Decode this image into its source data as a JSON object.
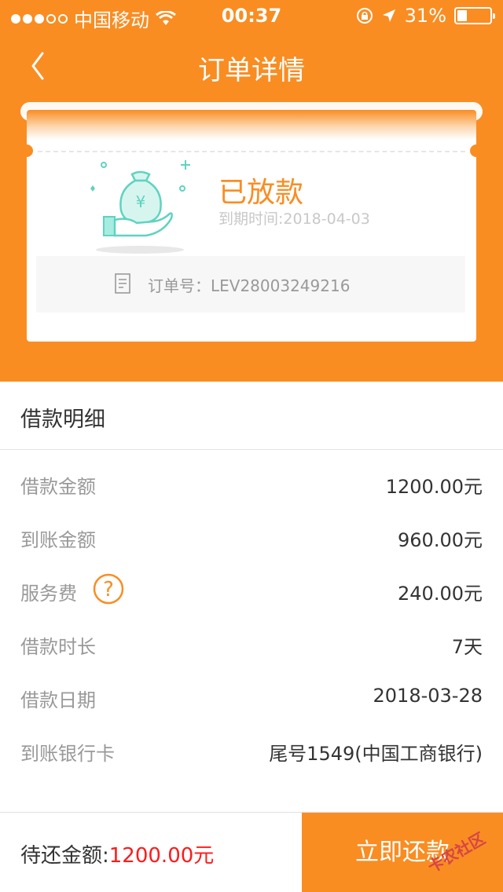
{
  "status_bar": {
    "carrier": "中国移动",
    "time": "00:37",
    "battery": "31%",
    "battery_level": 0.31
  },
  "nav": {
    "title": "订单详情"
  },
  "loan_card": {
    "status": "已放款",
    "due_date": "到期时间:2018-04-03",
    "order_number": "订单号：LEV28003249216"
  },
  "details": {
    "heading": "借款明细",
    "rows": [
      {
        "label": "借款金额",
        "value": "1200.00元"
      },
      {
        "label": "到账金额",
        "value": "960.00元"
      },
      {
        "label": "服务费",
        "value": "240.00元"
      },
      {
        "label": "借款时长",
        "value": "7天"
      },
      {
        "label": "借款日期",
        "value": "2018-03-28"
      },
      {
        "label": "到账银行卡",
        "value": "尾号1549(中国工商银行)"
      }
    ]
  },
  "bottom": {
    "pending_label": "待还金额:",
    "pending_amount": "1200.00元",
    "pay_button": "立即还款"
  },
  "watermark": "卡农社区",
  "colors": {
    "accent": "#f98d22",
    "illustration": "#5fd3c0",
    "amount": "#ff1a1a"
  }
}
